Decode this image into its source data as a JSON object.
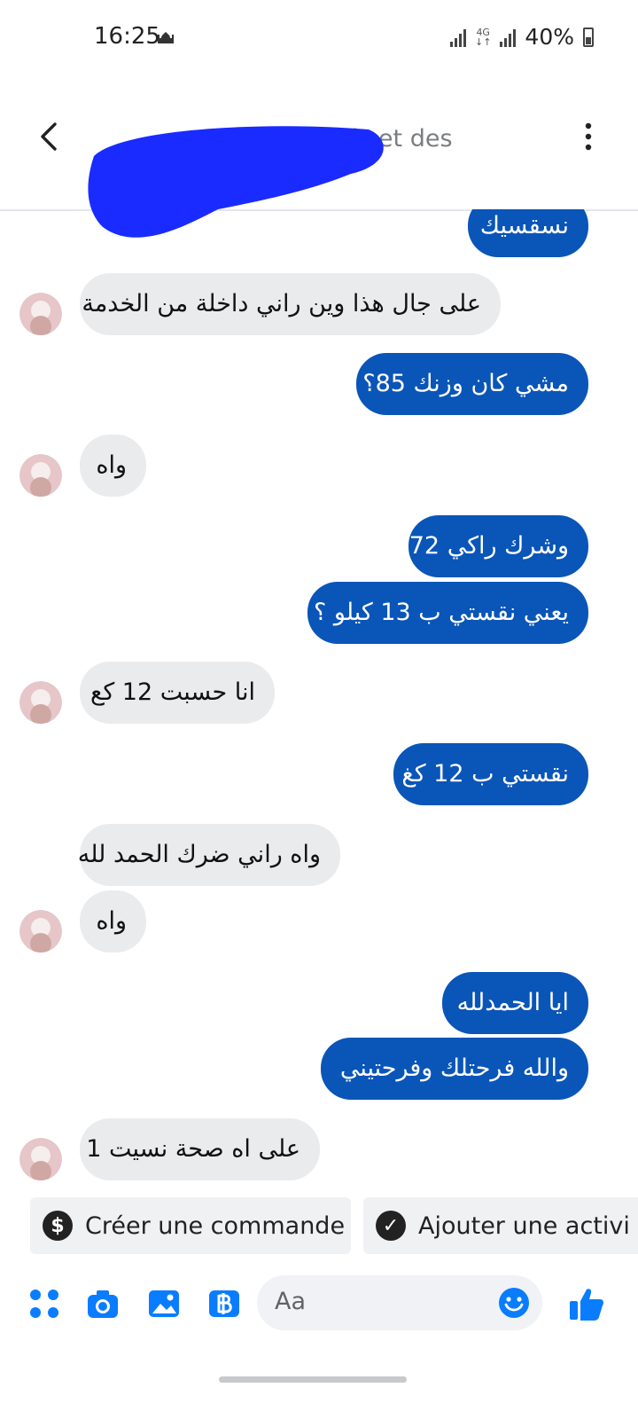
{
  "status_bar": {
    "time": "16:25",
    "network": "4G",
    "battery": "40%"
  },
  "header": {
    "subtitle": "ajouter des détails et des libellés",
    "subtitle_visible": "uter des détails et des libellés"
  },
  "messages": [
    {
      "dir": "out",
      "text": "نسقسيك"
    },
    {
      "dir": "in",
      "text": "على جال هذا وين راني داخلة من الخدمة"
    },
    {
      "dir": "out",
      "text": "مشي كان وزنك 85؟"
    },
    {
      "dir": "in",
      "text": "واه"
    },
    {
      "dir": "out",
      "text": "وشرك راكي 72"
    },
    {
      "dir": "out",
      "text": "يعني نقستي ب 13 كيلو ؟"
    },
    {
      "dir": "in",
      "text": "انا حسبت 12 كع"
    },
    {
      "dir": "out",
      "text": "نقستي ب 12 كغ"
    },
    {
      "dir": "in",
      "text": "واه راني ضرك الحمد لله"
    },
    {
      "dir": "in",
      "text": "واه"
    },
    {
      "dir": "out",
      "text": "ايا الحمدلله"
    },
    {
      "dir": "out",
      "text": "والله فرحتلك وفرحتيني"
    },
    {
      "dir": "in",
      "text": "على اه صحة نسيت 1"
    }
  ],
  "quick_actions": [
    {
      "label": "Créer une commande",
      "icon": "dollar-icon"
    },
    {
      "label": "Ajouter une activi",
      "icon": "check-circle-icon"
    }
  ],
  "composer": {
    "placeholder": "Aa"
  },
  "colors": {
    "outgoing_bubble": "#0a55b8",
    "incoming_bubble": "#eaebed",
    "accent": "#0a7cff"
  }
}
